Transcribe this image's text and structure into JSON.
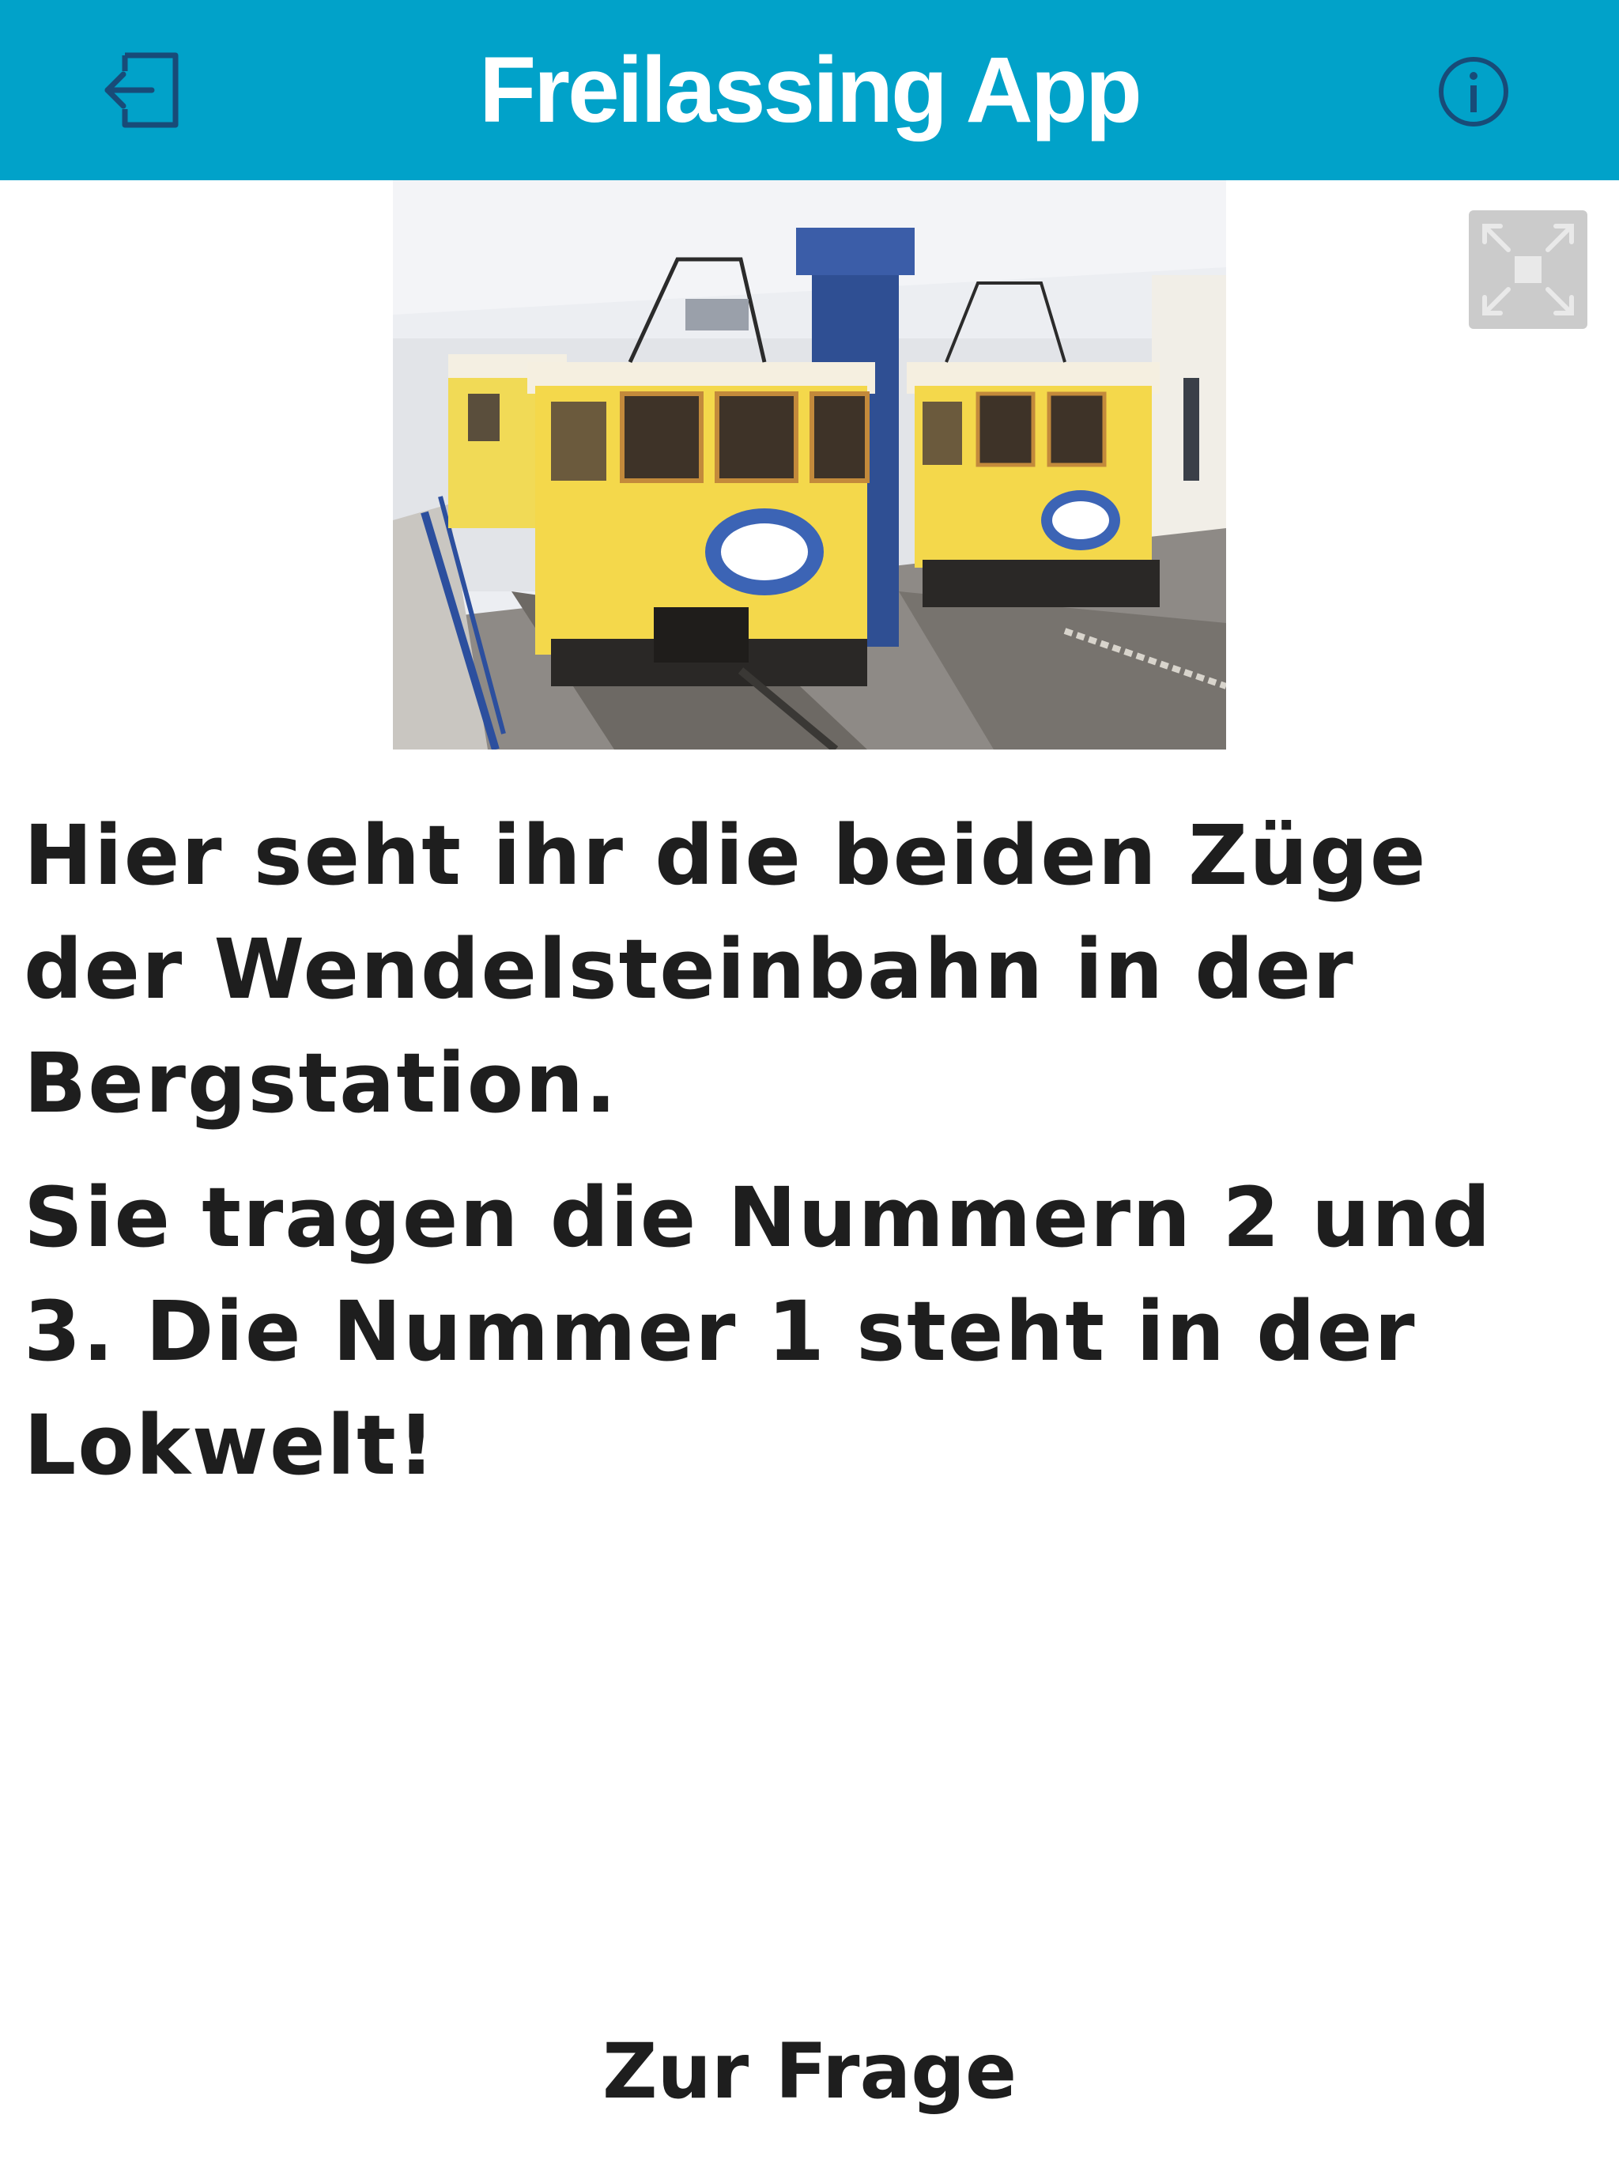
{
  "header": {
    "title": "Freilassing App",
    "exit_icon": "exit-icon",
    "info_icon": "info-icon",
    "background_color": "#01a2c9"
  },
  "content": {
    "image_alt": "Wendelsteinbahn trains in mountain station",
    "paragraphs": [
      "Hier seht ihr die beiden Züge der Wendelsteinbahn in der Bergstation.",
      "Sie tragen die Nummern 2 und 3. Die Nummer 1 steht in der Lokwelt!"
    ],
    "fullscreen_icon": "fullscreen-icon"
  },
  "footer": {
    "next_label": "Zur Frage"
  }
}
